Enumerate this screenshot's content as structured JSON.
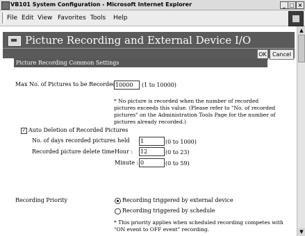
{
  "window": {
    "title": "VB101 System Configuration - Microsoft Internet Explorer",
    "minimize": "_",
    "maximize": "□",
    "close": "×"
  },
  "menu": {
    "file": "File",
    "edit": "Edit",
    "view": "View",
    "favorites": "Favorites",
    "tools": "Tools",
    "help": "Help"
  },
  "header": {
    "title": "Picture Recording and External Device I/O",
    "ok": "OK",
    "cancel": "Cancel"
  },
  "section": {
    "title": "Picture Recording Common Settings"
  },
  "max_pictures": {
    "label": "Max No. of Pictures to be Recorded",
    "value": "10000",
    "range": "(1 to 10000)",
    "note": "* No picture is recorded when the number of recorded pictures exceeds this value. (Please refer to \"No. of recorded pictures\" on the Administration Tools Page for the number of pictures already recorded.)"
  },
  "auto_delete": {
    "label": "Auto Deletion of Recorded Pictures",
    "checked": "✓",
    "days_label": "No. of days recorded pictures held",
    "days_value": "1",
    "days_range": "(0 to 1000)",
    "time_label": "Recorded picture delete time",
    "hour_label": "Hour :",
    "hour_value": "12",
    "hour_range": "(0 to 23)",
    "minute_label": "Minute :",
    "minute_value": "0",
    "minute_range": "(0 to 59)"
  },
  "priority": {
    "label": "Recording Priority",
    "option_external": "Recording triggered by external device",
    "option_schedule": "Recording triggered by schedule",
    "selected": "external",
    "note": "* This priority applies when scheduled recording competes with \"ON event to OFF event\" recording."
  },
  "scrollbar": {
    "up": "▲",
    "down": "▼"
  }
}
